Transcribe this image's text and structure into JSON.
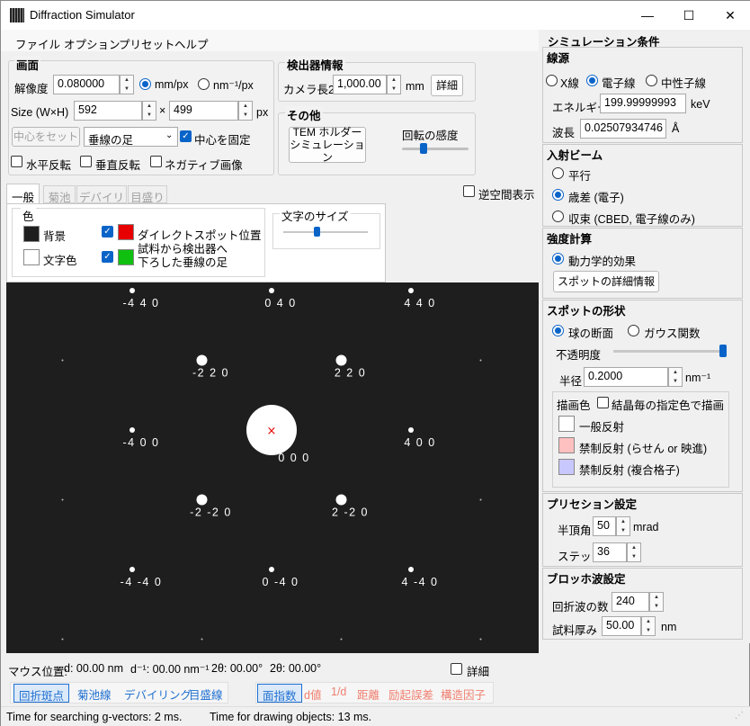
{
  "window": {
    "title": "Diffraction Simulator",
    "minimize": "—",
    "maximize": "☐",
    "close": "✕"
  },
  "menu": [
    "ファイル",
    "オプション",
    "プリセット",
    "ヘルプ"
  ],
  "screen": {
    "title": "画面",
    "resolution_label": "解像度",
    "resolution": "0.080000",
    "unit_mmpx": "mm/px",
    "unit_nm": "nm⁻¹/px",
    "size_label": "Size (W×H)",
    "width": "592",
    "times": "×",
    "height": "499",
    "px": "px",
    "center_btn": "中心をセット",
    "center_select": "垂線の足",
    "fix_center": "中心を固定",
    "hflip": "水平反転",
    "vflip": "垂直反転",
    "negative": "ネガティブ画像"
  },
  "detector": {
    "title": "検出器情報",
    "camera_label": "カメラ長2",
    "camera": "1,000.00",
    "mm": "mm",
    "detail_btn": "詳細"
  },
  "other": {
    "title": "その他",
    "tem_btn_1": "TEM ホルダー",
    "tem_btn_2": "シミュレーション",
    "rotation_label": "回転の感度"
  },
  "tabs": [
    "一般",
    "菊池",
    "デバイリン",
    "目盛り"
  ],
  "reciprocal": "逆空間表示",
  "general_tab": {
    "color_title": "色",
    "bg": "背景",
    "text_color": "文字色",
    "direct_spot": "ダイレクトスポット位置",
    "foot_1": "試料から検出器へ",
    "foot_2": "下ろした垂線の足",
    "font_size": "文字のサイズ",
    "colors": {
      "bg": "#1e1e1e",
      "text": "#ffffff",
      "direct": "#e80000",
      "foot": "#10c010"
    }
  },
  "spots": [
    {
      "label": "-4 4 0"
    },
    {
      "label": "0 4 0"
    },
    {
      "label": "4 4 0"
    },
    {
      "label": "-2 2 0"
    },
    {
      "label": "2 2 0"
    },
    {
      "label": "-4 0 0"
    },
    {
      "label": "0 0 0"
    },
    {
      "label": "4 0 0"
    },
    {
      "label": "-2 -2 0"
    },
    {
      "label": "2 -2 0"
    },
    {
      "label": "-4 -4 0"
    },
    {
      "label": "0 -4 0"
    },
    {
      "label": "4 -4 0"
    }
  ],
  "direct_marker": "×",
  "mouse": {
    "label": "マウス位置:",
    "d": "d: 00.00 nm",
    "dinv": "d⁻¹: 00.00 nm⁻¹",
    "tt1": "2θ: 00.00°",
    "tt2": "2θ: 00.00°",
    "detail": "詳細"
  },
  "bottom_tabs_left": [
    "回折斑点",
    "菊池線",
    "デバイリング",
    "目盛線"
  ],
  "bottom_tabs_right": [
    "面指数",
    "d値",
    "1/d",
    "距離",
    "励起誤差",
    "構造因子"
  ],
  "status": {
    "gsearch": "Time for searching g-vectors: 2 ms.",
    "gdraw": "Time for drawing objects: 13 ms."
  },
  "sim": {
    "title": "シミュレーション条件",
    "source": {
      "title": "線源",
      "xray": "X線",
      "electron": "電子線",
      "neutron": "中性子線",
      "energy_label": "エネルギー",
      "energy": "199.99999993",
      "kev": "keV",
      "wave_label": "波長",
      "wave": "0.02507934746",
      "angstrom": "Å"
    },
    "beam": {
      "title": "入射ビーム",
      "parallel": "平行",
      "precession": "歳差 (電子)",
      "converge": "収束 (CBED, 電子線のみ)"
    },
    "intensity": {
      "title": "強度計算",
      "dynamic": "動力学的効果",
      "spot_btn": "スポットの詳細情報"
    },
    "shape": {
      "title": "スポットの形状",
      "sphere": "球の断面",
      "gauss": "ガウス関数",
      "opacity": "不透明度",
      "radius_label": "半径",
      "radius": "0.2000",
      "nm": "nm⁻¹",
      "draw_color": "描画色",
      "per_crystal": "結晶毎の指定色で描画",
      "general": "一般反射",
      "forbid_screw": "禁制反射 (らせん or 映進)",
      "forbid_complex": "禁制反射 (複合格子)",
      "colors": {
        "general": "#ffffff",
        "screw": "#ffc0c0",
        "complex": "#c8c8ff"
      }
    },
    "precession": {
      "title": "プリセション設定",
      "half_angle_label": "半頂角",
      "half_angle": "50",
      "mrad": "mrad",
      "step_label": "ステップ",
      "step": "36"
    },
    "bloch": {
      "title": "ブロッホ波設定",
      "num_label": "回折波の数",
      "num": "240",
      "thick_label": "試料厚み",
      "thick": "50.00",
      "nm": "nm"
    }
  }
}
